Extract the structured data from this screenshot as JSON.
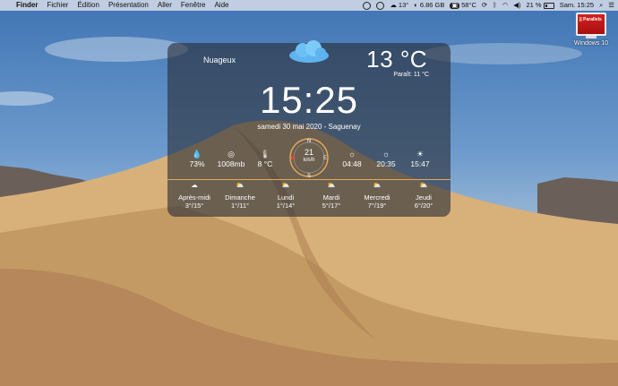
{
  "menubar": {
    "apple_symbol": "",
    "menus": [
      "Finder",
      "Fichier",
      "Édition",
      "Présentation",
      "Aller",
      "Fenêtre",
      "Aide"
    ],
    "status": {
      "weather_temp": "13°",
      "memory": "6.86 GB",
      "cpu_temp": "58°C",
      "battery": "21 %",
      "clock": "Sam. 15:25"
    }
  },
  "widget": {
    "condition": "Nuageux",
    "temperature": "13 °C",
    "feels_like": "Paraît:  11 °C",
    "time": "15:25",
    "date_location": "samedi 30 mai 2020 - Saguenay",
    "humidity": "73%",
    "pressure": "1008mb",
    "dewpoint": "8 °C",
    "wind_speed": "21",
    "wind_unit": "km/h",
    "compass": {
      "n": "N",
      "s": "S",
      "e": "E",
      "w": "W"
    },
    "dawn": "04:48",
    "sunset": "20:35",
    "daylight": "15:47",
    "accent_color": "#e2a85a",
    "forecast": [
      {
        "day": "Après-midi",
        "temps": "3°/15°"
      },
      {
        "day": "Dimanche",
        "temps": "1°/11°"
      },
      {
        "day": "Lundi",
        "temps": "1°/14°"
      },
      {
        "day": "Mardi",
        "temps": "5°/17°"
      },
      {
        "day": "Mercredi",
        "temps": "7°/19°"
      },
      {
        "day": "Jeudi",
        "temps": "6°/20°"
      }
    ]
  },
  "desktop_icon": {
    "label": "Windows 10",
    "badge": "|| Parallels"
  }
}
